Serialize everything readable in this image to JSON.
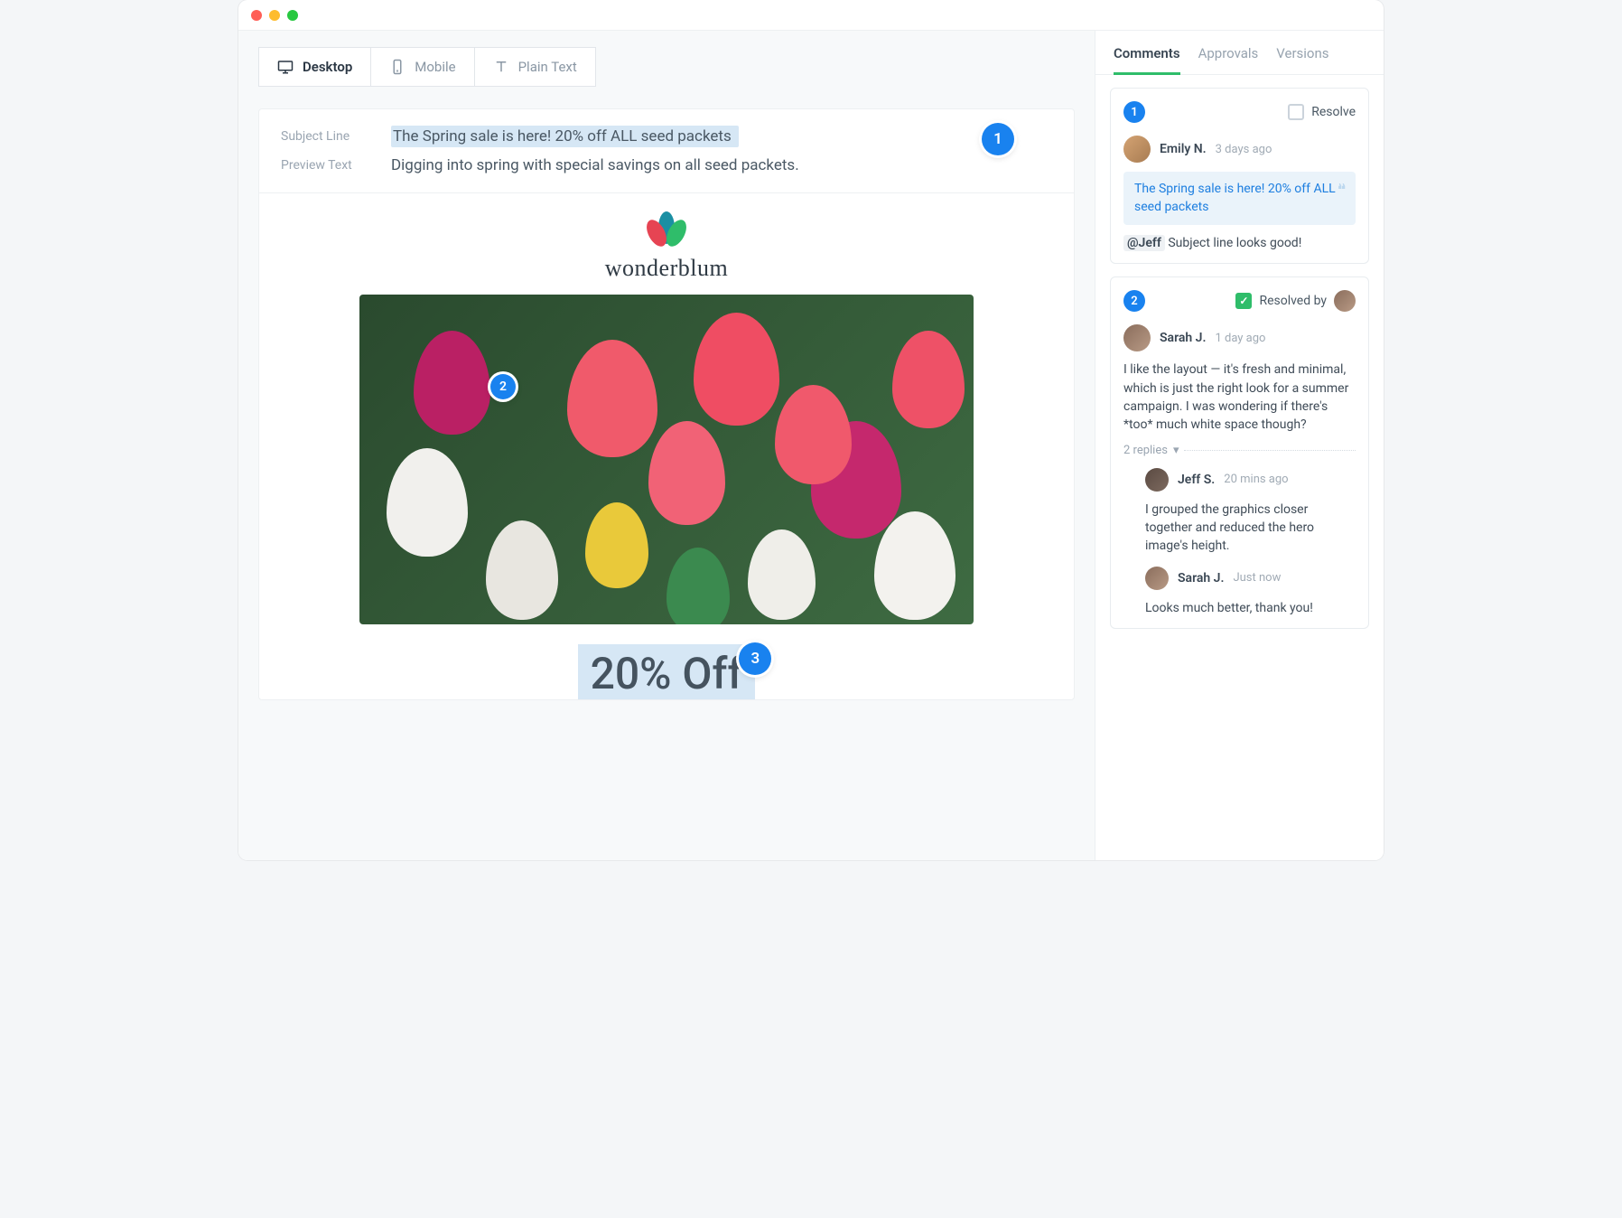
{
  "viewtabs": {
    "desktop": "Desktop",
    "mobile": "Mobile",
    "plaintext": "Plain Text"
  },
  "email": {
    "subjectLabel": "Subject Line",
    "subject": "The Spring sale is here! 20% off ALL seed packets",
    "previewLabel": "Preview Text",
    "preview": "Digging into spring with special savings on all seed packets.",
    "brand": "wonderblum",
    "offer": "20% Off"
  },
  "markers": {
    "m1": "1",
    "m2": "2",
    "m3": "3"
  },
  "sidetabs": {
    "comments": "Comments",
    "approvals": "Approvals",
    "versions": "Versions"
  },
  "c1": {
    "num": "1",
    "resolveLabel": "Resolve",
    "author": "Emily N.",
    "time": "3 days ago",
    "quote": "The Spring sale is here! 20% off ALL seed packets",
    "mention": "@Jeff",
    "body": "Subject line looks good!"
  },
  "c2": {
    "num": "2",
    "resolvedBy": "Resolved by",
    "author": "Sarah J.",
    "time": "1 day ago",
    "body": "I like the layout — it's fresh and minimal, which is just the right look for a summer campaign. I was wondering if there's *too* much white space though?",
    "repliesLabel": "2 replies",
    "r1": {
      "author": "Jeff S.",
      "time": "20 mins ago",
      "body": "I grouped the graphics closer together and reduced the hero image's height."
    },
    "r2": {
      "author": "Sarah J.",
      "time": "Just now",
      "body": "Looks much better, thank you!"
    }
  }
}
